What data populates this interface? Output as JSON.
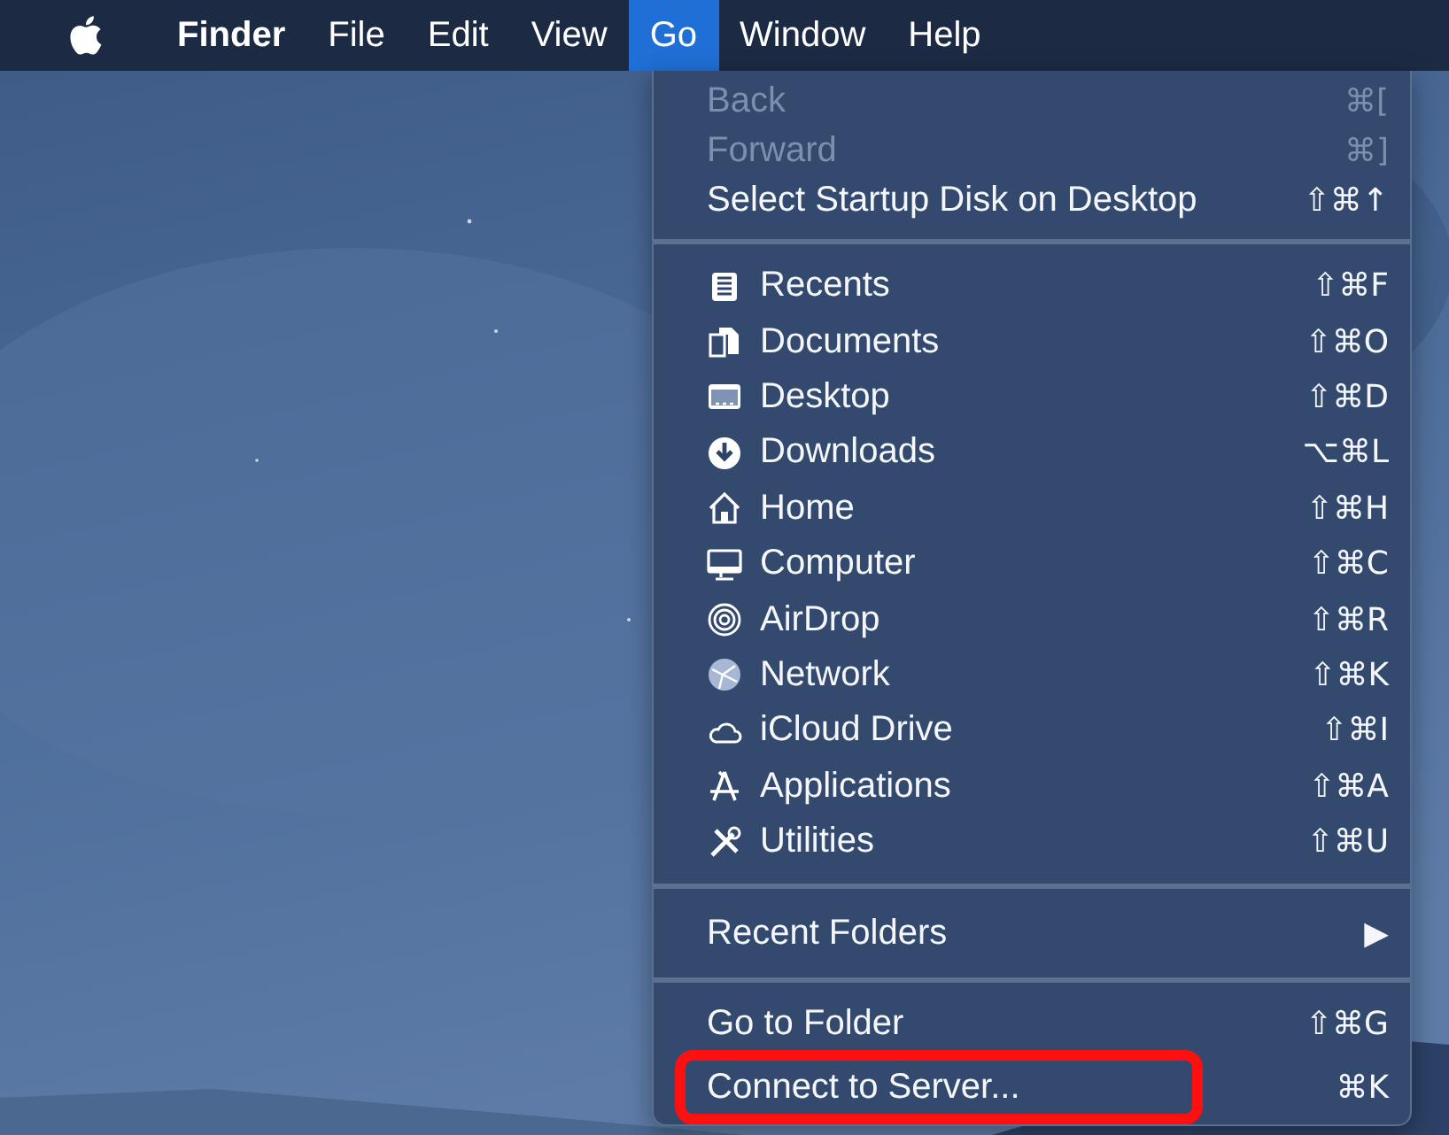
{
  "menu_bar": [
    {
      "label": "Finder",
      "kind": "app",
      "selected": false
    },
    {
      "label": "File",
      "kind": "menu",
      "selected": false
    },
    {
      "label": "Edit",
      "kind": "menu",
      "selected": false
    },
    {
      "label": "View",
      "kind": "menu",
      "selected": false
    },
    {
      "label": "Go",
      "kind": "menu",
      "selected": true
    },
    {
      "label": "Window",
      "kind": "menu",
      "selected": false
    },
    {
      "label": "Help",
      "kind": "menu",
      "selected": false
    }
  ],
  "go_menu": {
    "sections": [
      [
        {
          "label": "Back",
          "shortcut": "⌘[",
          "disabled": true
        },
        {
          "label": "Forward",
          "shortcut": "⌘]",
          "disabled": true
        },
        {
          "label": "Select Startup Disk on Desktop",
          "shortcut": "⇧⌘↑",
          "disabled": false
        }
      ],
      [
        {
          "label": "Recents",
          "shortcut": "⇧⌘F",
          "disabled": false
        },
        {
          "label": "Documents",
          "shortcut": "⇧⌘O",
          "disabled": false
        },
        {
          "label": "Desktop",
          "shortcut": "⇧⌘D",
          "disabled": false
        },
        {
          "label": "Downloads",
          "shortcut": "⌥⌘L",
          "disabled": false
        },
        {
          "label": "Home",
          "shortcut": "⇧⌘H",
          "disabled": false
        },
        {
          "label": "Computer",
          "shortcut": "⇧⌘C",
          "disabled": false
        },
        {
          "label": "AirDrop",
          "shortcut": "⇧⌘R",
          "disabled": false
        },
        {
          "label": "Network",
          "shortcut": "⇧⌘K",
          "disabled": false
        },
        {
          "label": "iCloud Drive",
          "shortcut": "⇧⌘I",
          "disabled": false
        },
        {
          "label": "Applications",
          "shortcut": "⇧⌘A",
          "disabled": false
        },
        {
          "label": "Utilities",
          "shortcut": "⇧⌘U",
          "disabled": false
        }
      ],
      [
        {
          "label": "Recent Folders",
          "shortcut": "▶",
          "disabled": false
        }
      ],
      [
        {
          "label": "Go to Folder",
          "shortcut": "⇧⌘G",
          "disabled": false
        },
        {
          "label": "Connect to Server...",
          "shortcut": "⌘K",
          "disabled": false,
          "annotated": true
        }
      ]
    ]
  }
}
